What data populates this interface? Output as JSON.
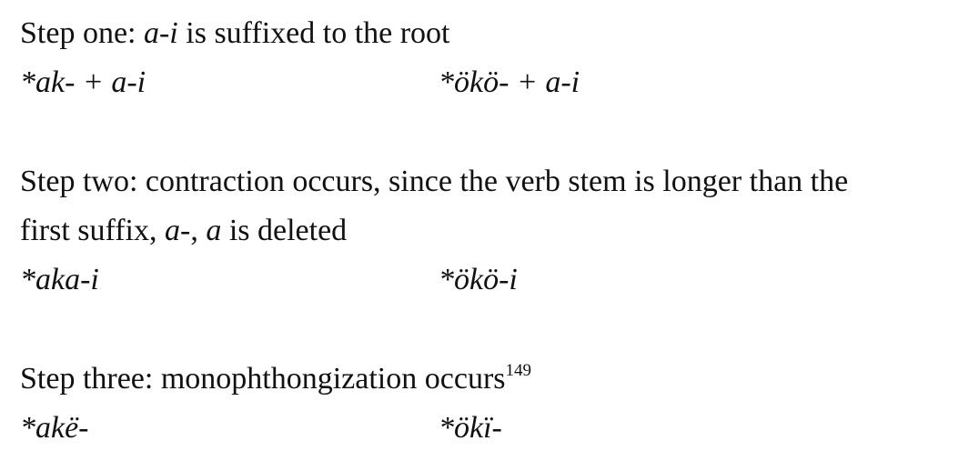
{
  "step1": {
    "label": "Step one: ",
    "affix": "a-i",
    "rest": " is suffixed to the root",
    "form_left": "*ak- + a-i",
    "form_right": "*ökö- + a-i"
  },
  "step2": {
    "line1": "Step two: contraction occurs, since the verb stem is longer than the",
    "line2_prefix": "first suffix, ",
    "suffix": "a-",
    "comma": ", ",
    "vowel": "a",
    "line2_suffix": " is deleted",
    "form_left": "*aka-i",
    "form_right": "*ökö-i"
  },
  "step3": {
    "text": "Step three: monophthongization occurs",
    "footnote": "149",
    "form_left": "*akë-",
    "form_right": "*ökï-"
  }
}
